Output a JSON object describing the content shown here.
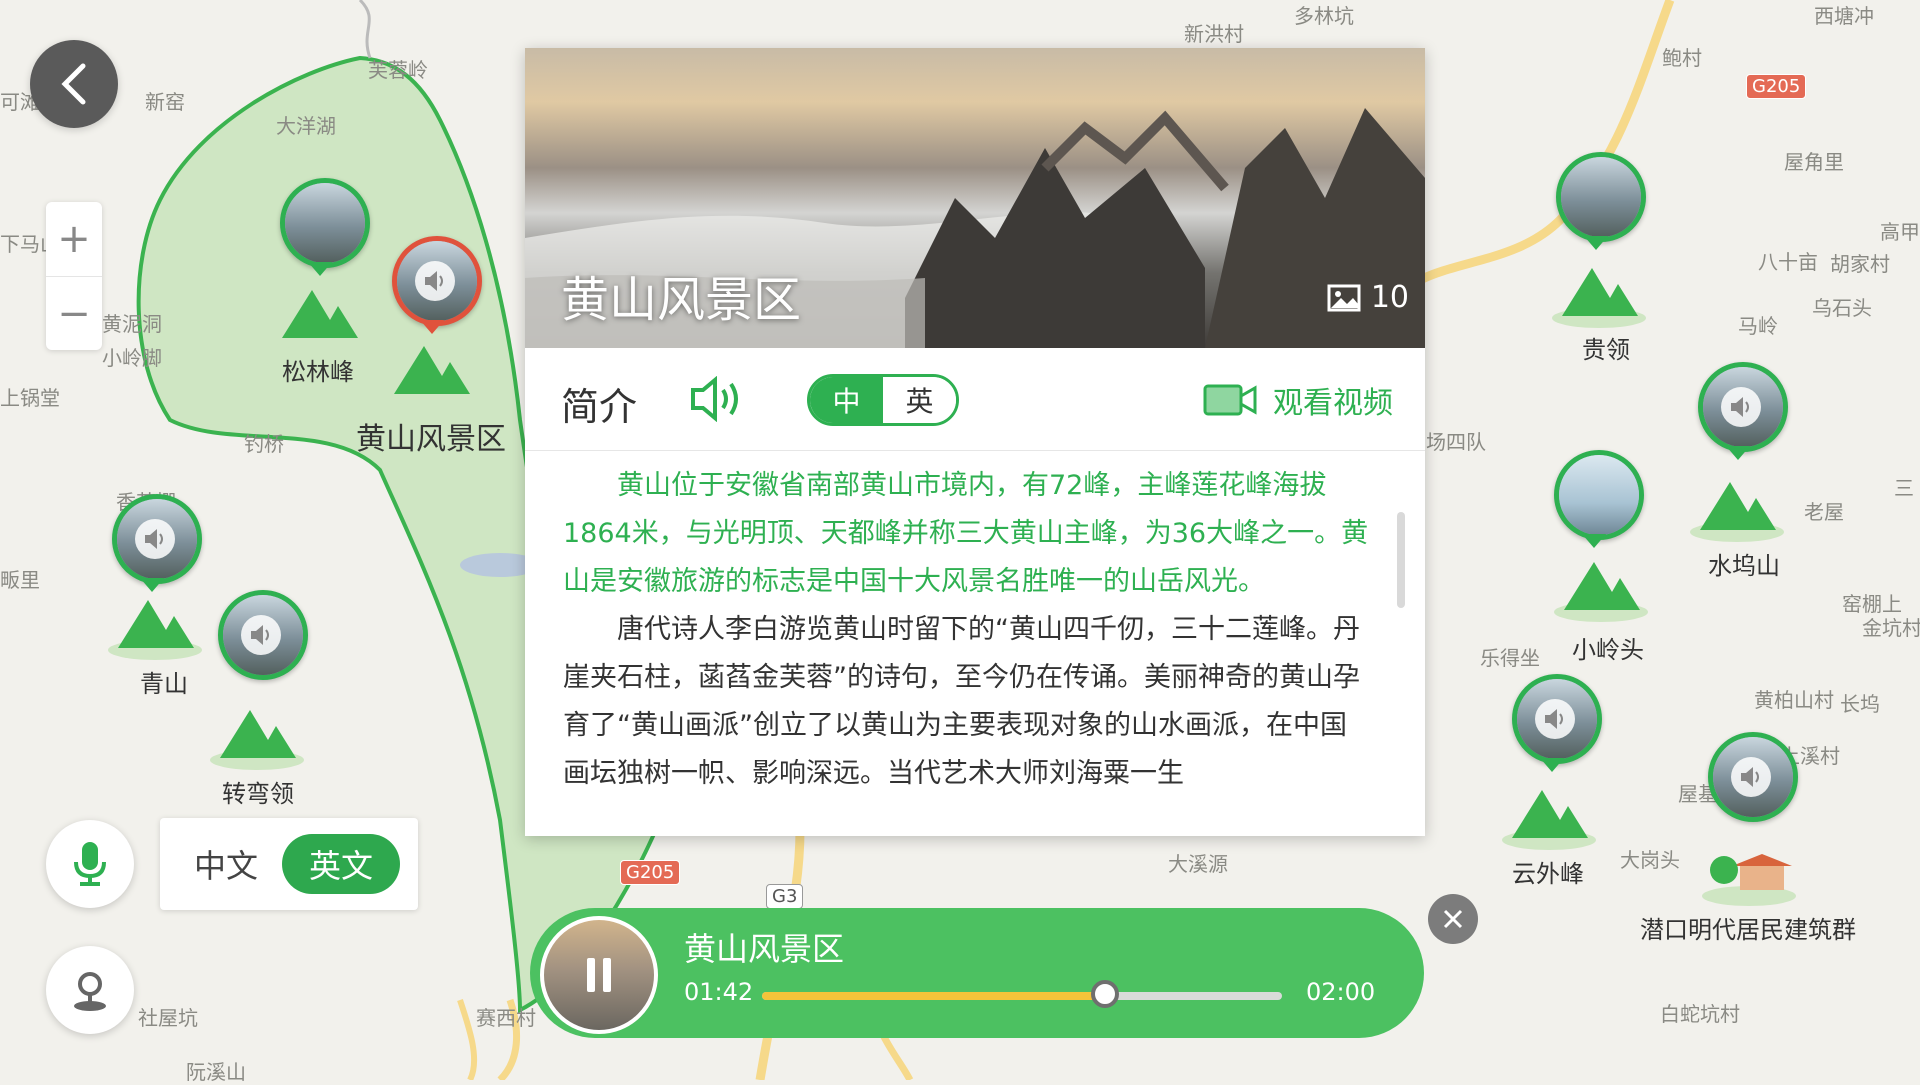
{
  "map_labels": [
    "芙蓉岭",
    "新窑",
    "大洋湖",
    "下马山",
    "黄泥洞",
    "小岭脚",
    "上锅堂",
    "钓桥",
    "香茶棚",
    "畈里",
    "社屋坑",
    "阮溪山",
    "赛西村",
    "大溪源",
    "新洪村",
    "多林坑",
    "鲍村",
    "西塘冲",
    "屋角里",
    "八十亩",
    "胡家村",
    "乌石头",
    "马岭",
    "老屋",
    "场四队",
    "乐得坐",
    "窑棚上",
    "金坑村",
    "黄柏山村",
    "长坞",
    "上溪村",
    "屋基",
    "大岗头",
    "白蛇坑村",
    "高甲",
    "可滩",
    "三",
    "G205",
    "G205",
    "G3"
  ],
  "controls": {
    "back_icon": "chevron-left-icon",
    "zoom_in": "+",
    "zoom_out": "−",
    "voice_lang": {
      "cn": "中文",
      "en": "英文"
    }
  },
  "pois": [
    {
      "label": "松林峰"
    },
    {
      "label": "黄山风景区"
    },
    {
      "label": "青山"
    },
    {
      "label": "转弯领"
    },
    {
      "label": "贵领"
    },
    {
      "label": "水坞山"
    },
    {
      "label": "小岭头"
    },
    {
      "label": "云外峰"
    },
    {
      "label": "潜口明代居民建筑群"
    }
  ],
  "card": {
    "title": "黄山风景区",
    "photo_count": "10",
    "intro_title": "简介",
    "lang_cn": "中",
    "lang_en": "英",
    "video_label": "观看视频",
    "para1": "黄山位于安徽省南部黄山市境内，有72峰，主峰莲花峰海拔1864米，与光明顶、天都峰并称三大黄山主峰，为36大峰之一。黄山是安徽旅游的标志是中国十大风景名胜唯一的山岳风光。",
    "para2": "唐代诗人李白游览黄山时留下的“黄山四千仞，三十二莲峰。丹崖夹石柱，菡萏金芙蓉”的诗句，至今仍在传诵。美丽神奇的黄山孕育了“黄山画派”创立了以黄山为主要表现对象的山水画派，在中国画坛独树一帜、影响深远。当代艺术大师刘海粟一生"
  },
  "player": {
    "title": "黄山风景区",
    "current": "01:42",
    "total": "02:00",
    "progress": 0.66
  },
  "colors": {
    "accent": "#2eb051",
    "player_bg": "#4cc161",
    "progress": "#f3c43a"
  }
}
